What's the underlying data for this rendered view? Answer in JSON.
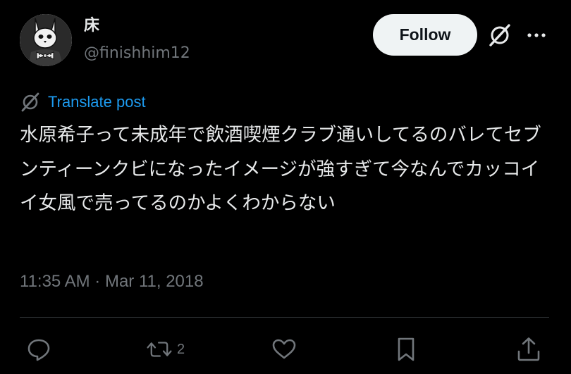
{
  "user": {
    "display_name": "床",
    "handle": "@finishhim12"
  },
  "header": {
    "follow_label": "Follow"
  },
  "translate": {
    "label": "Translate post"
  },
  "post": {
    "text": "水原希子って未成年で飲酒喫煙クラブ通いしてるのバレてセブンティーンクビになったイメージが強すぎて今なんでカッコイイ女風で売ってるのかよくわからない",
    "timestamp": "11:35 AM · Mar 11, 2018"
  },
  "actions": {
    "reply_count": "",
    "repost_count": "2",
    "like_count": ""
  },
  "colors": {
    "background": "#000000",
    "text_primary": "#e7e9ea",
    "text_secondary": "#71767b",
    "link_blue": "#1d9bf0",
    "follow_bg": "#eff3f4",
    "divider": "#2f3336"
  },
  "icons": {
    "avatar": "rabbit-mask-avatar",
    "grok": "grok-icon",
    "more": "more-dots-icon",
    "translate": "translate-icon",
    "reply": "reply-icon",
    "repost": "repost-icon",
    "like": "heart-icon",
    "bookmark": "bookmark-icon",
    "share": "share-icon"
  }
}
